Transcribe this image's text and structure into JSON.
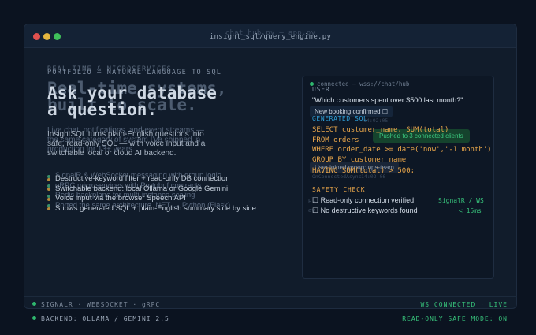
{
  "window": {
    "title_ghost": "chat_hub.py — app.py",
    "title": "insight_sql/query_engine.py"
  },
  "left": {
    "eyebrow_ghost": "REAL-TIME & MICROSERVICES",
    "eyebrow": "PORTFOLIO — NATURAL LANGUAGE TO SQL",
    "headline_ghost_1": "Real-time systems,",
    "headline_ghost_2": "built to scale.",
    "headline_1": "Ask your database",
    "headline_2": "a question.",
    "desc_ghost": "Live chat, notifications, and event streams — the same category of system I've shipped in production for 13+ years.",
    "desc": "InsightSQL turns plain-English questions into safe, read-only SQL — with voice input and a switchable local or cloud AI backend.",
    "bullets_ghost": [
      "SignalR & WebSocket messaging with group logic",
      "gRPC microservices with Protobuf contracts",
      "Redis backplane for multi-instance scaling",
      "Ported the same architecture .NET → Python (Flask)"
    ],
    "bullets": [
      "Destructive-keyword filter + read-only DB connection",
      "Switchable backend: local Ollama or Google Gemini",
      "Voice input via the browser Speech API",
      "Shows generated SQL + plain-English summary side by side"
    ]
  },
  "panel": {
    "connection": "connected — wss://chat/hub",
    "user_label": "USER",
    "question": "\"Which customers spent over $500 last month?\"",
    "booking_pill": "New booking confirmed ☐",
    "generated_label": "GENERATED SQL",
    "ghost_time": "14:02:05",
    "pushed_pill": "Pushed to 3 connected clients",
    "sql_lines": [
      "SELECT customer_name, SUM(total)",
      "FROM orders",
      "WHERE order_date >= date('now','-1 month')",
      "GROUP BY customer_name",
      "HAVING SUM(total) > 500;"
    ],
    "joined_pill": "User joined group: ops-team",
    "onconnected": "OnConnectedAsync",
    "onconnected_time": "14:02:06",
    "safety_label": "SAFETY CHECK",
    "checks": [
      "☐ Read-only connection verified",
      "☐ No destructive keywords found"
    ],
    "ghost_label_1": "pl",
    "ghost_label_2": "av",
    "signalr": "SignalR / WS",
    "latency": "< 15ms"
  },
  "status": {
    "bar1_left": "SIGNALR · WEBSOCKET · gRPC",
    "bar1_right": "WS CONNECTED · LIVE",
    "bar2_left": "BACKEND: OLLAMA / GEMINI 2.5",
    "bar2_right": "READ-ONLY SAFE MODE: ON"
  },
  "colors": {
    "background": "#0b1320",
    "accent_green": "#37c17a",
    "accent_orange": "#e9a64a"
  }
}
